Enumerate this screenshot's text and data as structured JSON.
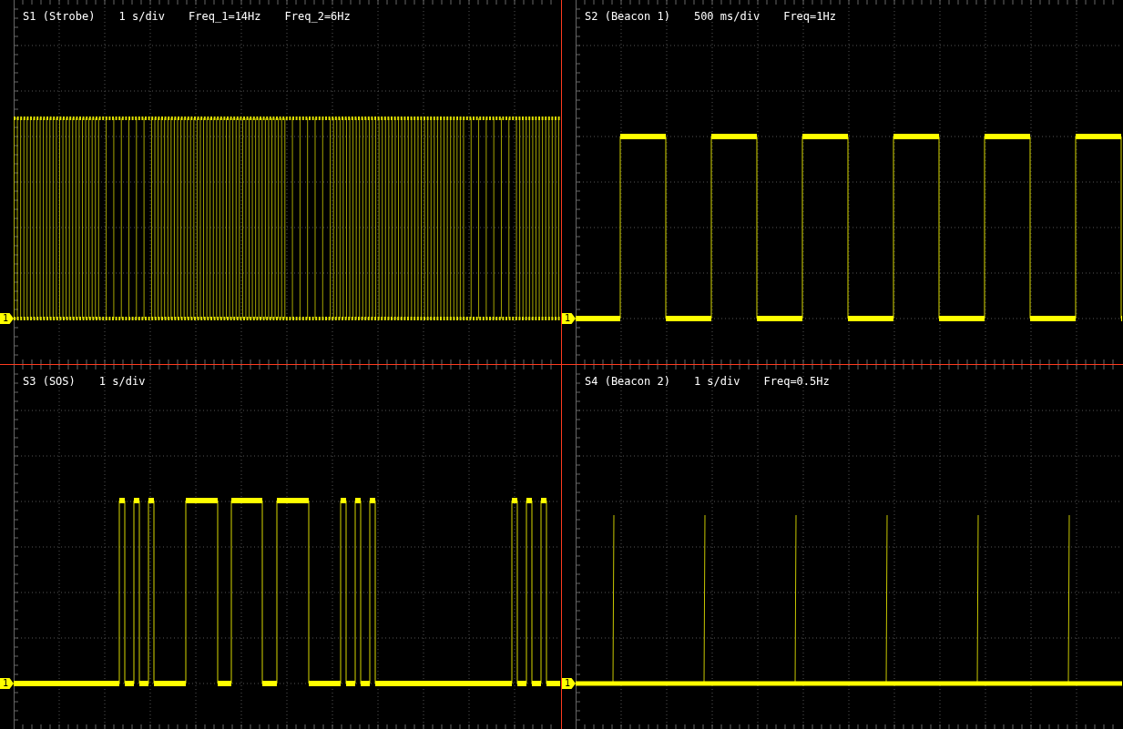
{
  "panels": [
    {
      "kind": "strobe",
      "title": "S1 (Strobe)",
      "timebase": "1 s/div",
      "readouts": [
        "Freq_1=14Hz",
        "Freq_2=6Hz"
      ],
      "channel": "1"
    },
    {
      "kind": "square",
      "title": "S2 (Beacon 1)",
      "timebase": "500 ms/div",
      "readouts": [
        "Freq=1Hz"
      ],
      "channel": "1"
    },
    {
      "kind": "sos",
      "title": "S3 (SOS)",
      "timebase": "1 s/div",
      "channel": "1"
    },
    {
      "kind": "pulse",
      "title": "S4 (Beacon 2)",
      "timebase": "1 s/div",
      "readouts": [
        "Freq=0.5Hz"
      ],
      "channel": "1"
    }
  ]
}
